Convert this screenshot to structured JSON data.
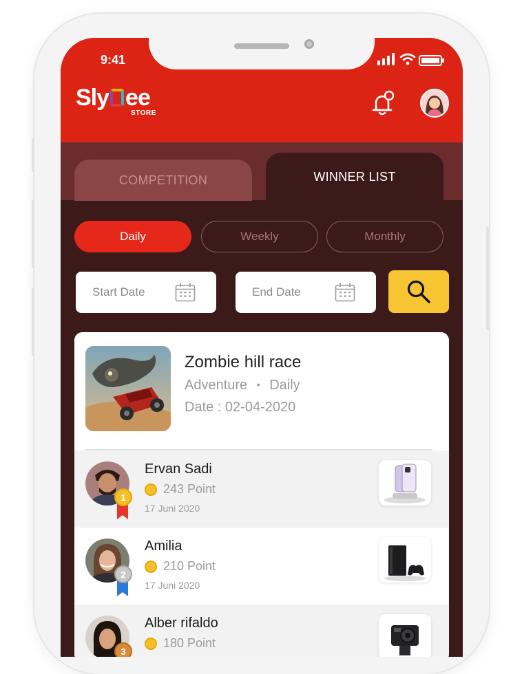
{
  "status_bar": {
    "time": "9:41"
  },
  "brand": {
    "logo_text_left": "Sly",
    "logo_text_right": "ee",
    "logo_sub": "STORE"
  },
  "tabs": [
    {
      "label": "COMPETITION",
      "active": false
    },
    {
      "label": "WINNER LIST",
      "active": true
    }
  ],
  "period_filters": [
    {
      "label": "Daily",
      "selected": true
    },
    {
      "label": "Weekly",
      "selected": false
    },
    {
      "label": "Monthly",
      "selected": false
    }
  ],
  "date_filter": {
    "start_placeholder": "Start Date",
    "end_placeholder": "End Date"
  },
  "game": {
    "title": "Zombie hill race",
    "genre": "Adventure",
    "separator": "•",
    "period": "Daily",
    "date": "Date : 02-04-2020"
  },
  "winners": [
    {
      "rank": "1",
      "name": "Ervan Sadi",
      "points": "243 Point",
      "date": "17 Juni 2020",
      "prize_icon": "smartphone-icon"
    },
    {
      "rank": "2",
      "name": "Amilia",
      "points": "210 Point",
      "date": "17 Juni 2020",
      "prize_icon": "game-console-icon"
    },
    {
      "rank": "3",
      "name": "Alber rifaldo",
      "points": "180 Point",
      "date": "",
      "prize_icon": "action-camera-icon"
    }
  ],
  "colors": {
    "header_red": "#dc2415",
    "background_maroon": "#3c1a1a",
    "accent_red": "#e6281a",
    "search_yellow": "#f7c531"
  }
}
